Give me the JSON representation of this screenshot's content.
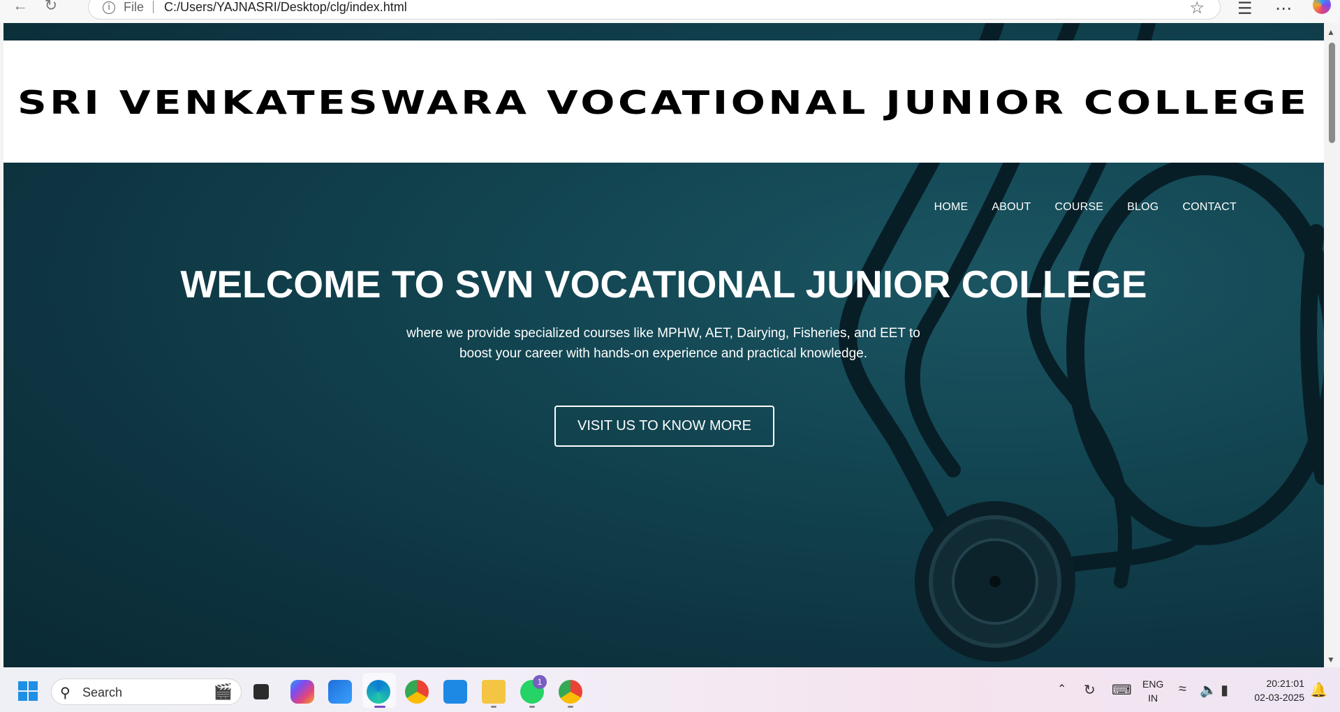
{
  "browser": {
    "file_label": "File",
    "url": "C:/Users/YAJNASRI/Desktop/clg/index.html",
    "icons": [
      "back-arrow-icon",
      "refresh-icon",
      "info-icon",
      "star-icon",
      "favorites-icon",
      "more-icon",
      "copilot-icon"
    ]
  },
  "site": {
    "logo_text": "SRI VENKATESWARA VOCATIONAL JUNIOR COLLEGE",
    "nav": [
      {
        "label": "HOME"
      },
      {
        "label": "ABOUT"
      },
      {
        "label": "COURSE"
      },
      {
        "label": "BLOG"
      },
      {
        "label": "CONTACT"
      }
    ],
    "hero_title": "WELCOME TO SVN VOCATIONAL JUNIOR COLLEGE",
    "hero_subtitle": "where we provide specialized courses like MPHW, AET, Dairying, Fisheries, and EET to boost your career with hands-on experience and practical knowledge.",
    "cta_label": "VISIT US TO KNOW MORE",
    "colors": {
      "hero_bg": "#0f3a47",
      "text": "#ffffff",
      "banner_bg": "#ffffff"
    }
  },
  "taskbar": {
    "search_placeholder": "Search",
    "apps": [
      "file-explorer-icon",
      "copilot-icon",
      "store-icon",
      "edge-icon",
      "chrome-icon",
      "vscode-icon",
      "folder-icon",
      "whatsapp-icon",
      "chrome-profile-icon"
    ],
    "whatsapp_badge": "1",
    "lang_top": "ENG",
    "lang_bottom": "IN",
    "time": "20:21:01",
    "date": "02-03-2025"
  }
}
